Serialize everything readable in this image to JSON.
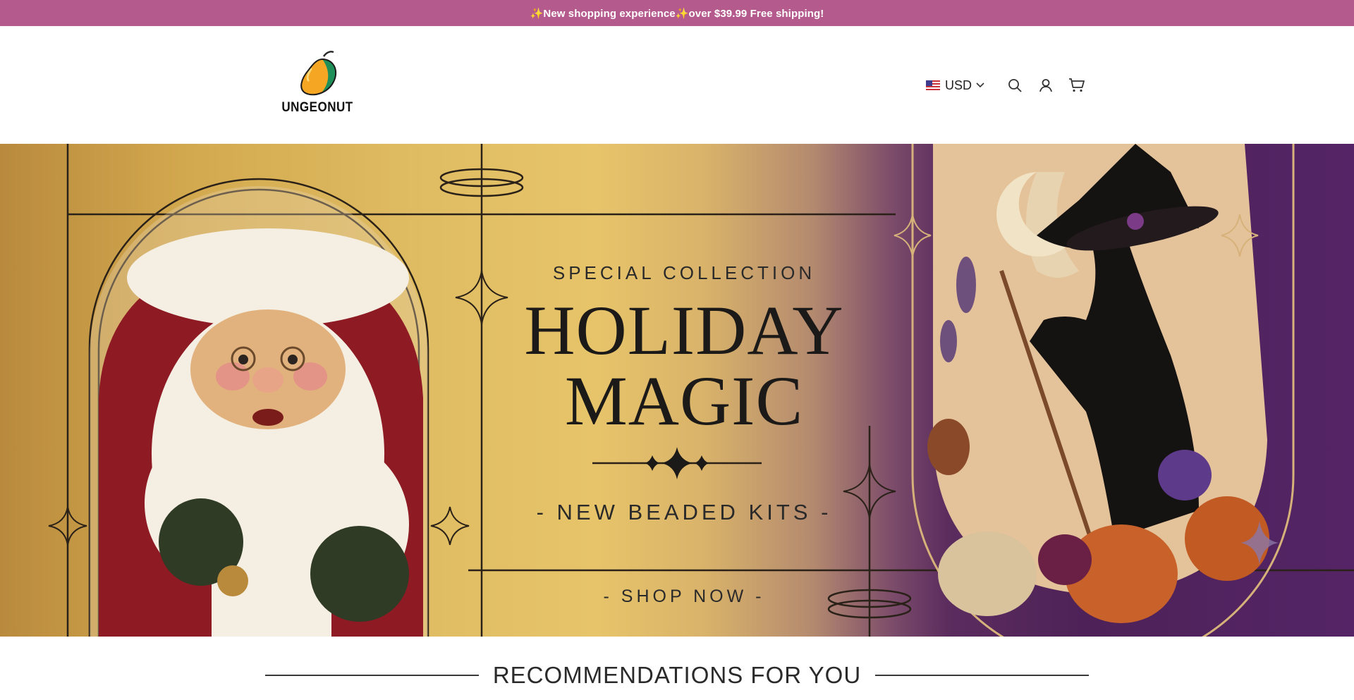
{
  "announcement": {
    "text": "✨New shopping experience✨over $39.99 Free shipping!"
  },
  "header": {
    "logo_text": "UNGEONUT",
    "currency": {
      "code": "USD",
      "flag": "us-flag-icon"
    },
    "icons": [
      "search-icon",
      "account-icon",
      "cart-icon"
    ]
  },
  "hero": {
    "eyebrow": "SPECIAL COLLECTION",
    "headline_line1": "HOLIDAY",
    "headline_line2": "MAGIC",
    "subheadline": "- NEW BEADED KITS -",
    "cta": "- SHOP NOW -",
    "colors": {
      "gold": "#e0bd63",
      "purple": "#4e2258",
      "announce": "#b55a8c"
    }
  },
  "recommendations": {
    "title": "RECOMMENDATIONS FOR YOU"
  }
}
